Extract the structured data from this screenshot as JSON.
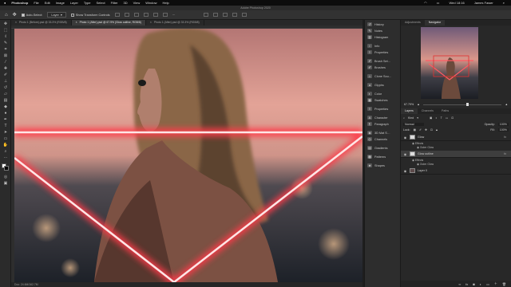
{
  "menubar": {
    "apple": "",
    "items": [
      "Photoshop",
      "File",
      "Edit",
      "Image",
      "Layer",
      "Type",
      "Select",
      "Filter",
      "3D",
      "View",
      "Window",
      "Help"
    ],
    "clock": "Wed 18:16",
    "user": "James Fawer"
  },
  "window_title": "Adobe Photoshop 2020",
  "options": {
    "auto_select_label": "Auto-Select:",
    "auto_select_value": "Layer",
    "show_transform": "Show Transform Controls"
  },
  "tabs": [
    {
      "label": "Photo 1 (Before).psd @ 33.3% (RGB/8)",
      "close": "×"
    },
    {
      "label": "Photo 1 (After).psd @ 67.9% (Glow outline, RGB/8)",
      "close": "×"
    },
    {
      "label": "Photo 1 (After).psd @ 33.3% (RGB/8)",
      "close": "×"
    }
  ],
  "status": "Doc: 24.6M/162.7M",
  "icon_panels": [
    "History",
    "Notes",
    "Histogram",
    "Info",
    "Properties",
    "Brush Set…",
    "Brushes",
    "Clone Sou…",
    "Glyphs",
    "Color",
    "Swatches",
    "Properties",
    "Character",
    "Paragraph",
    "3D Mat S…",
    "Channels",
    "Gradients",
    "Patterns",
    "Shapes"
  ],
  "right_panel": {
    "top_tabs": [
      "Adjustments",
      "Navigator"
    ],
    "zoom": "67.79%",
    "layer_tabs": [
      "Layers",
      "Channels",
      "Paths"
    ],
    "kind_label": "Kind",
    "blend_mode": "Normal",
    "opacity_label": "Opacity:",
    "opacity": "100%",
    "lock_label": "Lock:",
    "fill_label": "Fill:",
    "fill": "100%",
    "layers": [
      {
        "name": "Glow",
        "type": "shape",
        "fx": "fx",
        "effects_label": "Effects",
        "effect": "Outer Glow",
        "selected": false
      },
      {
        "name": "Glow outline",
        "type": "shape",
        "fx": "fx",
        "effects_label": "Effects",
        "effect": "Outer Glow",
        "selected": true
      },
      {
        "name": "Layer 0",
        "type": "photo",
        "fx": "",
        "selected": false
      }
    ]
  },
  "colors": {
    "neon_core": "#ffe6e6",
    "neon_glow": "#ff3b4a",
    "sky_top": "#b87a78",
    "sky_bottom": "#e9a89a"
  }
}
